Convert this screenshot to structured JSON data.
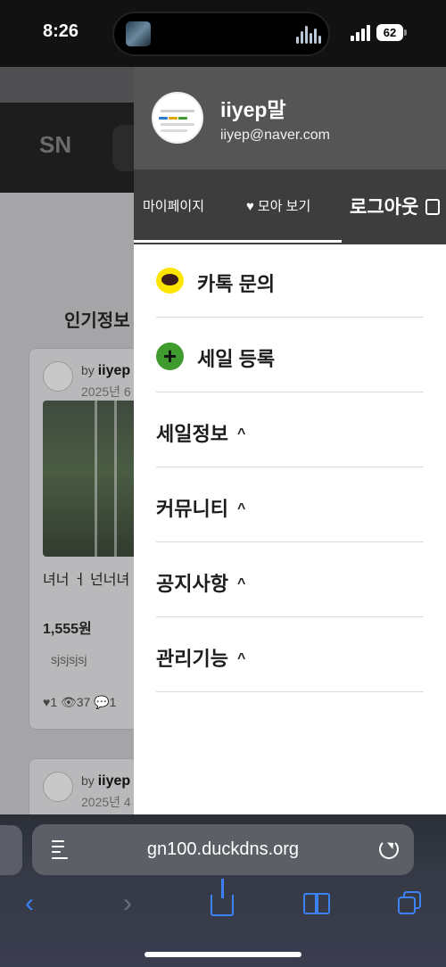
{
  "status_bar": {
    "time": "8:26",
    "battery": "62"
  },
  "background_page": {
    "logo": "SN",
    "section_title": "인기정보",
    "cards": [
      {
        "by_prefix": "by",
        "author": "iiyep",
        "date": "2025년 6",
        "title": "녀너 ㅓ 넌너녀",
        "price": "1,555원",
        "tag": "sjsjsjsj",
        "stats": "♥1 👁37 💬1"
      },
      {
        "by_prefix": "by",
        "author": "iiyep",
        "date": "2025년 4"
      }
    ]
  },
  "drawer": {
    "profile": {
      "name": "iiyep말",
      "email": "iiyep@naver.com"
    },
    "tabs": {
      "mypage": "마이페이지",
      "favorites": "모아 보기",
      "logout": "로그아웃"
    },
    "menu": [
      {
        "label": "카톡 문의",
        "icon": "kakao-talk-icon"
      },
      {
        "label": "세일 등록",
        "icon": "plus-circle-icon"
      },
      {
        "label": "세일정보",
        "icon": "chevron-up-icon"
      },
      {
        "label": "커뮤니티",
        "icon": "chevron-up-icon"
      },
      {
        "label": "공지사항",
        "icon": "chevron-up-icon"
      },
      {
        "label": "관리기능",
        "icon": "chevron-up-icon"
      }
    ]
  },
  "browser": {
    "url": "gn100.duckdns.org"
  },
  "colors": {
    "kakao": "#fee500",
    "plus": "#3f9b2e",
    "safari_accent": "#3b82f6",
    "drawer_header": "#555555"
  }
}
